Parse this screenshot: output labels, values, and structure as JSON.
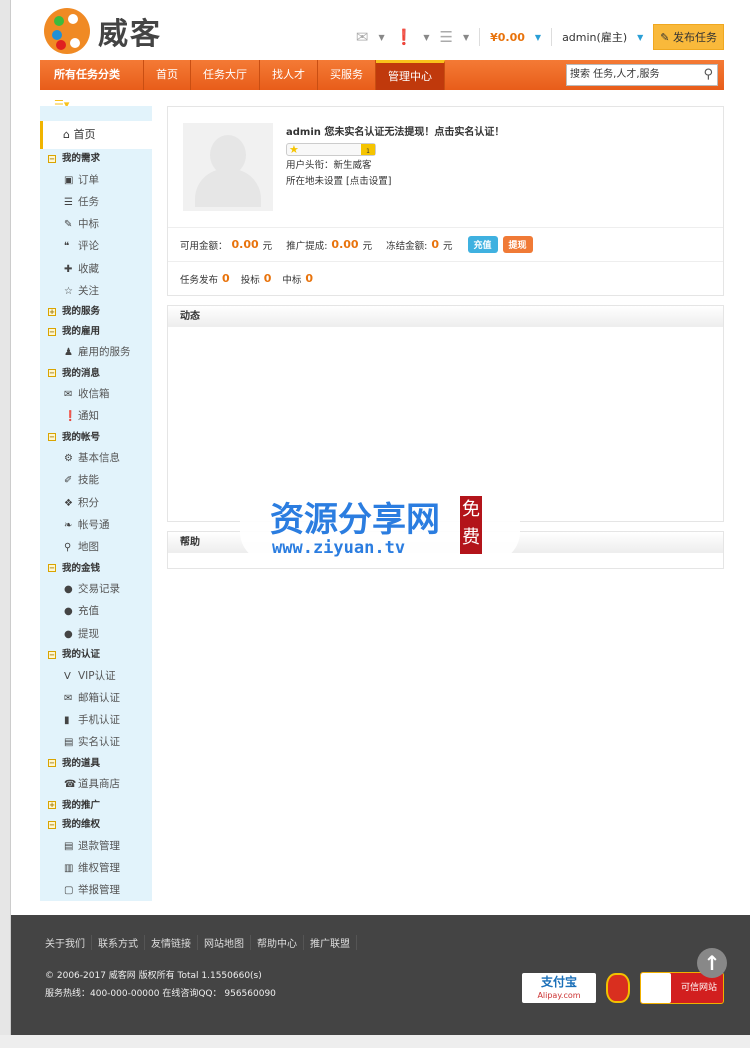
{
  "header": {
    "logo_text": "威客",
    "money": "¥0.00",
    "user": "admin(雇主)",
    "publish_label": "发布任务",
    "icons": [
      "mail-icon",
      "notice-icon",
      "rss-icon"
    ]
  },
  "nav": {
    "category": "所有任务分类",
    "items": [
      "首页",
      "任务大厅",
      "找人才",
      "买服务",
      "管理中心"
    ],
    "active": 4,
    "search_placeholder": "搜索 任务,人才,服务"
  },
  "sidebar": {
    "home": "首页",
    "groups": [
      {
        "label": "我的需求",
        "open": true,
        "items": [
          [
            "订单",
            "▣"
          ],
          [
            "任务",
            "☰"
          ],
          [
            "中标",
            "✎"
          ],
          [
            "评论",
            "❝"
          ],
          [
            "收藏",
            "✚"
          ],
          [
            "关注",
            "☆"
          ]
        ]
      },
      {
        "label": "我的服务",
        "open": false,
        "items": []
      },
      {
        "label": "我的雇用",
        "open": true,
        "items": [
          [
            "雇用的服务",
            "♟"
          ]
        ]
      },
      {
        "label": "我的消息",
        "open": true,
        "items": [
          [
            "收信箱",
            "✉"
          ],
          [
            "通知",
            "❗"
          ]
        ]
      },
      {
        "label": "我的帐号",
        "open": true,
        "items": [
          [
            "基本信息",
            "⚙"
          ],
          [
            "技能",
            "✐"
          ],
          [
            "积分",
            "❖"
          ],
          [
            "帐号通",
            "❧"
          ],
          [
            "地图",
            "⚲"
          ]
        ]
      },
      {
        "label": "我的金钱",
        "open": true,
        "items": [
          [
            "交易记录",
            "●"
          ],
          [
            "充值",
            "●"
          ],
          [
            "提现",
            "●"
          ]
        ]
      },
      {
        "label": "我的认证",
        "open": true,
        "items": [
          [
            "VIP认证",
            "V"
          ],
          [
            "邮箱认证",
            "✉"
          ],
          [
            "手机认证",
            "▮"
          ],
          [
            "实名认证",
            "▤"
          ]
        ]
      },
      {
        "label": "我的道具",
        "open": true,
        "items": [
          [
            "道具商店",
            "☎"
          ]
        ]
      },
      {
        "label": "我的推广",
        "open": false,
        "items": []
      },
      {
        "label": "我的维权",
        "open": true,
        "items": [
          [
            "退款管理",
            "▤"
          ],
          [
            "维权管理",
            "▥"
          ],
          [
            "举报管理",
            "▢"
          ]
        ]
      }
    ]
  },
  "profile": {
    "title": "admin 您未实名认证无法提现！点击实名认证！",
    "level": "1",
    "rank": "用户头衔：新生威客",
    "location": "所在地未设置",
    "location_link": "[点击设置]",
    "balance_label": "可用金额：",
    "balance": "0.00",
    "unit": "元",
    "promo_label": "推广提成:",
    "promo": "0.00",
    "frozen_label": "冻结金额:",
    "frozen": "0",
    "recharge": "充值",
    "withdraw": "提现",
    "tasks_label": "任务发布",
    "tasks": "0",
    "bids_label": "投标",
    "bids": "0",
    "wins_label": "中标",
    "wins": "0"
  },
  "panels": {
    "activity": "动态",
    "help": "帮助"
  },
  "watermark": {
    "text": "资源分享网",
    "url": "www.ziyuan.tv",
    "seal": "免费"
  },
  "footer": {
    "links": [
      "关于我们",
      "联系方式",
      "友情链接",
      "网站地图",
      "帮助中心",
      "推广联盟"
    ],
    "copyright": "© 2006-2017 威客网 版权所有 Total 1.1550660(s)",
    "hotline": "服务热线：400-000-00000 在线咨询QQ： 956560090",
    "alipay": "支付宝",
    "alipay_sub": "Alipay.com",
    "trust": "可信网站"
  },
  "colors": {
    "accent": "#e8730c",
    "nav": "#f06a28",
    "sidebar": "#e2f3fb",
    "footer": "#444444"
  }
}
